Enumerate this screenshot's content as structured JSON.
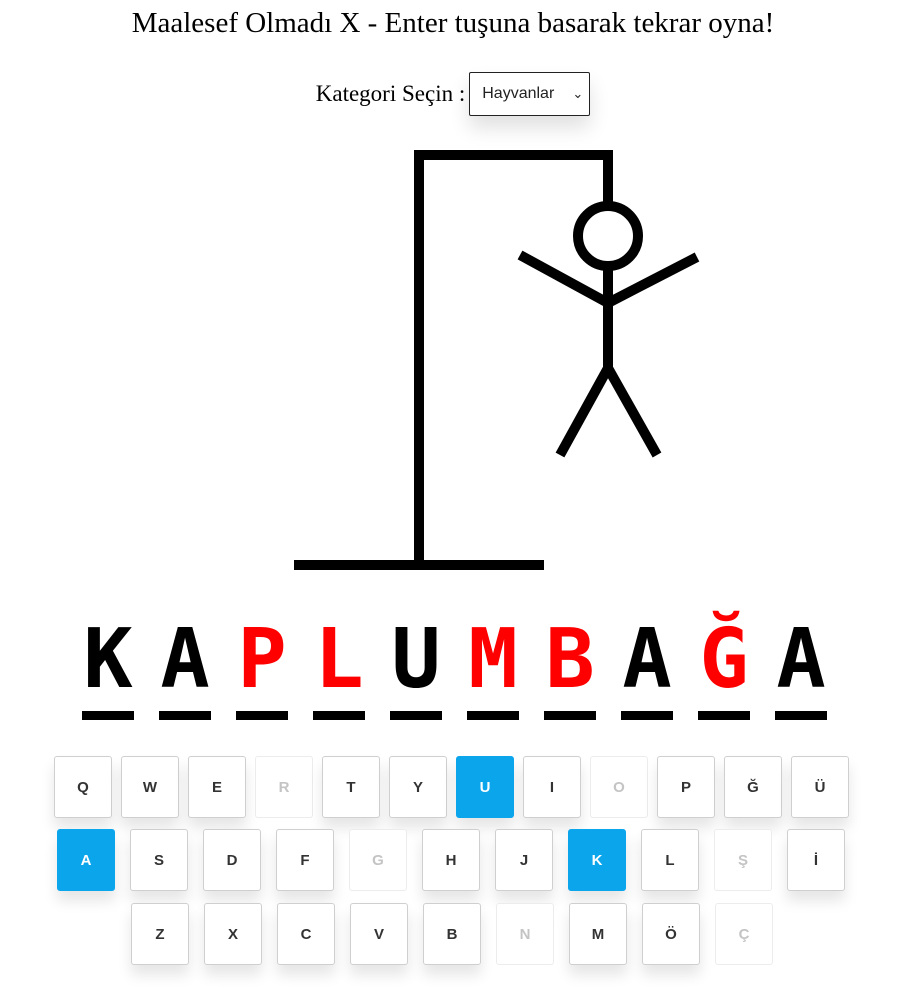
{
  "status_message": "Maalesef Olmadı X - Enter tuşuna basarak tekrar oyna!",
  "category": {
    "label": "Kategori Seçin :",
    "selected": "Hayvanlar"
  },
  "word": [
    {
      "char": "K",
      "state": "revealed"
    },
    {
      "char": "A",
      "state": "revealed"
    },
    {
      "char": "P",
      "state": "missed"
    },
    {
      "char": "L",
      "state": "missed"
    },
    {
      "char": "U",
      "state": "revealed"
    },
    {
      "char": "M",
      "state": "missed"
    },
    {
      "char": "B",
      "state": "missed"
    },
    {
      "char": "A",
      "state": "revealed"
    },
    {
      "char": "Ğ",
      "state": "missed"
    },
    {
      "char": "A",
      "state": "revealed"
    }
  ],
  "keyboard": {
    "rows": [
      [
        {
          "key": "Q",
          "state": "normal"
        },
        {
          "key": "W",
          "state": "normal"
        },
        {
          "key": "E",
          "state": "normal"
        },
        {
          "key": "R",
          "state": "used"
        },
        {
          "key": "T",
          "state": "normal"
        },
        {
          "key": "Y",
          "state": "normal"
        },
        {
          "key": "U",
          "state": "hit"
        },
        {
          "key": "I",
          "state": "normal"
        },
        {
          "key": "O",
          "state": "used"
        },
        {
          "key": "P",
          "state": "normal"
        },
        {
          "key": "Ğ",
          "state": "normal"
        },
        {
          "key": "Ü",
          "state": "normal"
        }
      ],
      [
        {
          "key": "A",
          "state": "hit"
        },
        {
          "key": "S",
          "state": "normal"
        },
        {
          "key": "D",
          "state": "normal"
        },
        {
          "key": "F",
          "state": "normal"
        },
        {
          "key": "G",
          "state": "used"
        },
        {
          "key": "H",
          "state": "normal"
        },
        {
          "key": "J",
          "state": "normal"
        },
        {
          "key": "K",
          "state": "hit"
        },
        {
          "key": "L",
          "state": "normal"
        },
        {
          "key": "Ş",
          "state": "used"
        },
        {
          "key": "İ",
          "state": "normal"
        }
      ],
      [
        {
          "key": "Z",
          "state": "normal"
        },
        {
          "key": "X",
          "state": "normal"
        },
        {
          "key": "C",
          "state": "normal"
        },
        {
          "key": "V",
          "state": "normal"
        },
        {
          "key": "B",
          "state": "normal"
        },
        {
          "key": "N",
          "state": "used"
        },
        {
          "key": "M",
          "state": "normal"
        },
        {
          "key": "Ö",
          "state": "normal"
        },
        {
          "key": "Ç",
          "state": "used"
        }
      ]
    ]
  },
  "colors": {
    "hit_key": "#0ba5ec",
    "missed_letter": "#ff0000",
    "revealed_letter": "#000000",
    "used_key_text": "#c4c4c4"
  }
}
